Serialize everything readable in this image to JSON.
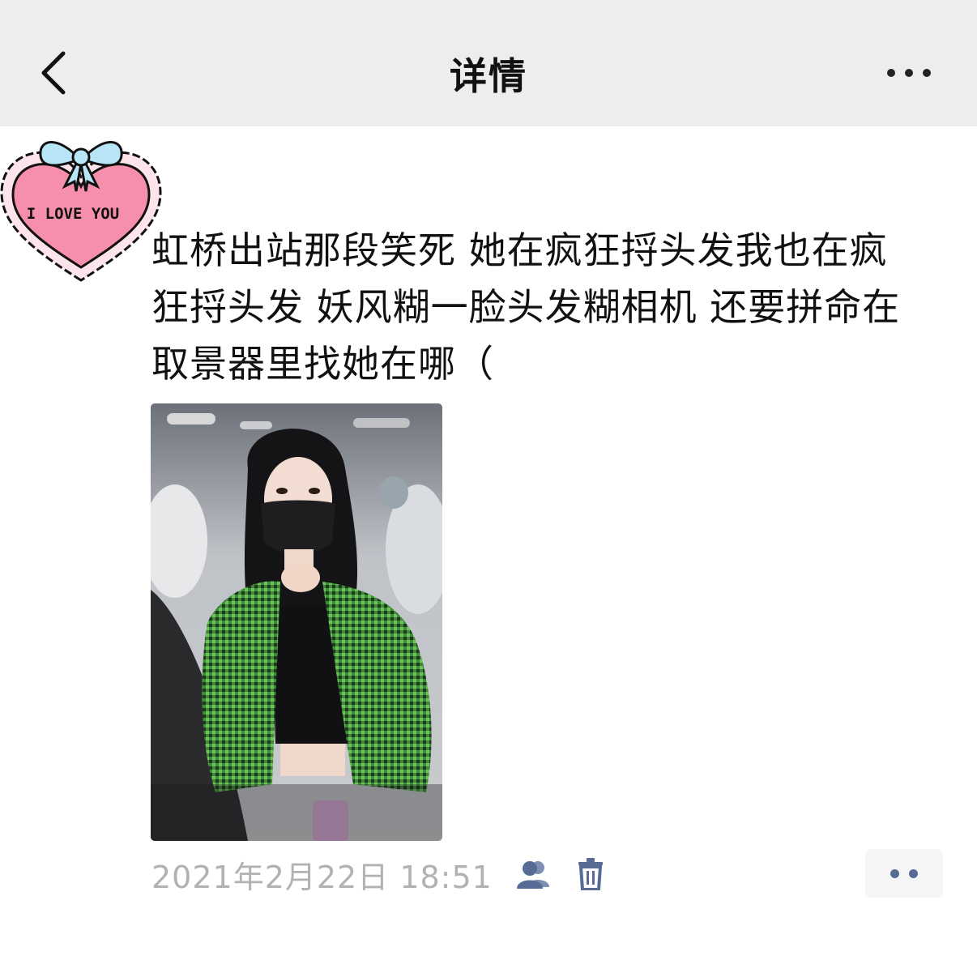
{
  "header": {
    "title": "详情",
    "back_icon": "chevron-left-icon",
    "more_icon": "more-dots-icon"
  },
  "avatar": {
    "sticker_text": "I LOVE YOU"
  },
  "post": {
    "text": "虹桥出站那段笑死 她在疯狂捋头发我也在疯\n狂捋头发 妖风糊一脸头发糊相机 还要拼命在\n取景器里找她在哪（",
    "timestamp": "2021年2月22日 18:51",
    "privacy_icon": "friends-visibility-icon",
    "delete_icon": "trash-icon",
    "action_icon": "comment-like-dots-icon"
  },
  "colors": {
    "nav_bg": "#ededed",
    "link_blue": "#576b95",
    "timestamp_gray": "#b2b2b2"
  }
}
